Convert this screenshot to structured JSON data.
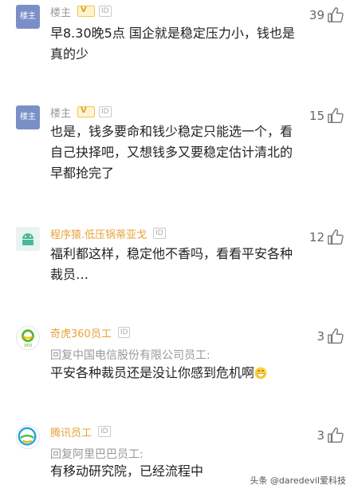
{
  "comments": [
    {
      "avatar_text": "楼主",
      "name": "楼主",
      "badge_v": "V",
      "badge_id": "ID",
      "text": "早8.30晚5点 国企就是稳定压力小，钱也是真的少",
      "likes": "39"
    },
    {
      "avatar_text": "楼主",
      "name": "楼主",
      "badge_v": "V",
      "badge_id": "ID",
      "text": "也是，钱多要命和钱少稳定只能选一个，看自己抉择吧，又想钱多又要稳定估计清北的早都抢完了",
      "likes": "15"
    },
    {
      "name": "程序猿.低压锅蒂亚戈",
      "badge_id": "ID",
      "text": "福利都这样，稳定他不香吗，看看平安各种裁员…",
      "likes": "12"
    },
    {
      "name": "奇虎360员工",
      "badge_id": "ID",
      "reply_to": "回复中国电信股份有限公司员工:",
      "text": "平安各种裁员还是没让你感到危机啊",
      "likes": "3"
    },
    {
      "name": "腾讯员工",
      "badge_id": "ID",
      "reply_to": "回复阿里巴巴员工:",
      "text": "有移动研究院，已经流程中",
      "likes": "3"
    }
  ],
  "watermark": "头条 @daredevil爱科技",
  "colors": {
    "highlight_name": "#e8a23a",
    "owner_avatar": "#7b8fc7",
    "muted": "#999999"
  },
  "icons": [
    "thumb-up-icon",
    "android-icon",
    "qihoo360-logo-icon",
    "tencent-logo-icon",
    "grinning-emoji-icon"
  ]
}
